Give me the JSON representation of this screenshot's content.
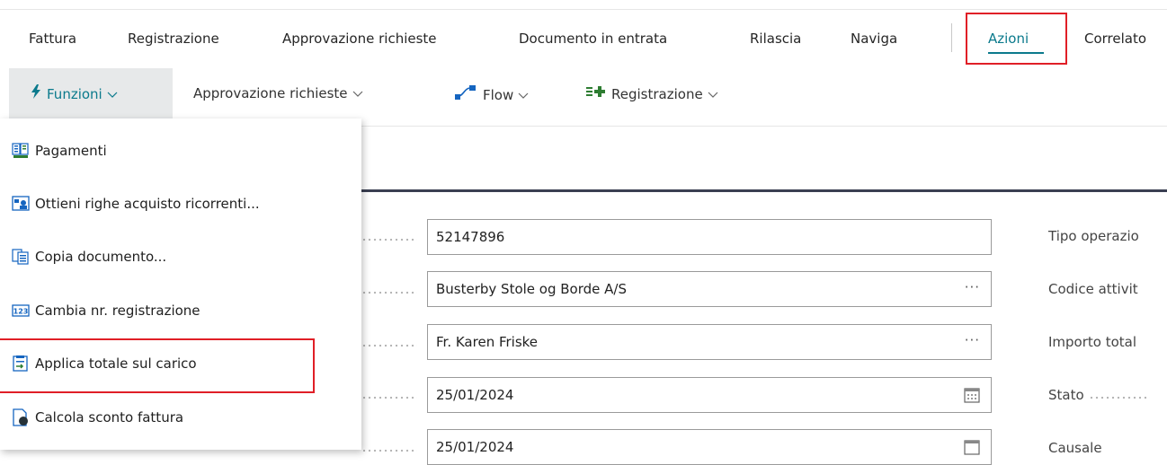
{
  "menu_bar": {
    "items": [
      "Fattura",
      "Registrazione",
      "Approvazione richieste",
      "Documento in entrata",
      "Rilascia",
      "Naviga"
    ],
    "active": "Azioni",
    "after": "Correlato"
  },
  "action_bar": {
    "funzioni": "Funzioni",
    "approvazione": "Approvazione richieste",
    "flow": "Flow",
    "registrazione": "Registrazione"
  },
  "dropdown": {
    "items": [
      {
        "label": "Pagamenti",
        "icon": "payments-icon"
      },
      {
        "label": "Ottieni righe acquisto ricorrenti...",
        "icon": "recurring-lines-icon"
      },
      {
        "label": "Copia documento...",
        "icon": "copy-document-icon"
      },
      {
        "label": "Cambia nr. registrazione",
        "icon": "number-123-icon"
      },
      {
        "label": "Applica totale sul carico",
        "icon": "apply-total-icon"
      },
      {
        "label": "Calcola sconto fattura",
        "icon": "calculate-discount-icon"
      }
    ]
  },
  "form": {
    "fields": [
      {
        "value": "52147896"
      },
      {
        "value": "Busterby Stole og Borde A/S",
        "ellipsis": "···"
      },
      {
        "value": "Fr. Karen Friske",
        "ellipsis": "···"
      },
      {
        "value": "25/01/2024"
      },
      {
        "value": "25/01/2024"
      }
    ],
    "right_labels": [
      "Tipo operazio",
      "Codice attivit",
      "Importo total",
      "Stato",
      "Causale"
    ]
  },
  "colors": {
    "accent": "#0b7a8c",
    "highlight_red": "#e01f27",
    "section_line": "#3a3f52"
  }
}
